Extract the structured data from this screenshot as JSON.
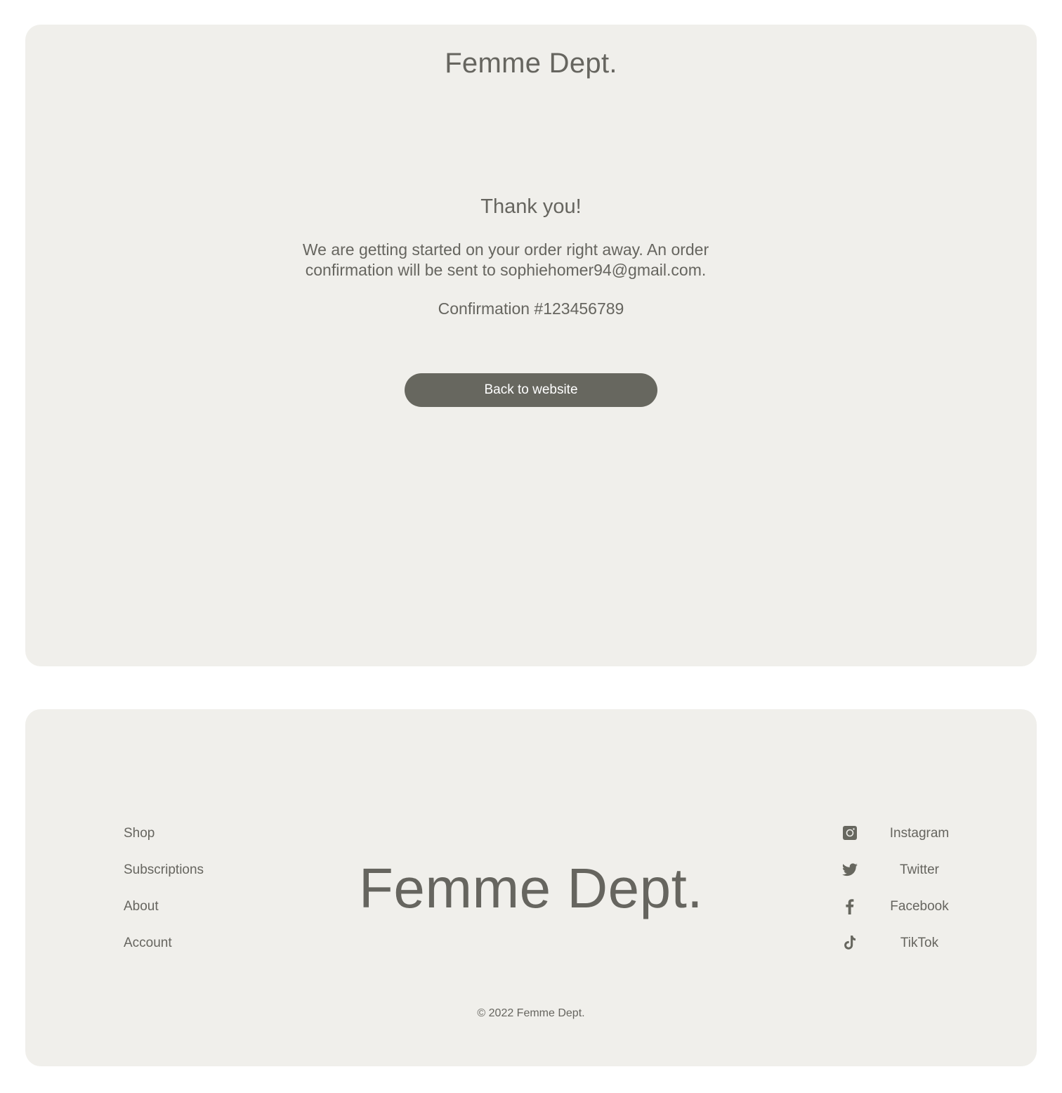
{
  "header": {
    "brand": "Femme Dept."
  },
  "confirmation": {
    "title": "Thank you!",
    "message": "We are getting started on your order right away. An order confirmation will be sent to sophiehomer94@gmail.com.",
    "number_text": "Confirmation #123456789",
    "back_button_label": "Back to website"
  },
  "footer": {
    "nav": [
      {
        "label": "Shop"
      },
      {
        "label": "Subscriptions"
      },
      {
        "label": "About"
      },
      {
        "label": "Account"
      }
    ],
    "brand": "Femme Dept.",
    "social": [
      {
        "label": "Instagram",
        "icon": "instagram-icon"
      },
      {
        "label": "Twitter",
        "icon": "twitter-icon"
      },
      {
        "label": "Facebook",
        "icon": "facebook-icon"
      },
      {
        "label": "TikTok",
        "icon": "tiktok-icon"
      }
    ],
    "copyright": "© 2022 Femme Dept."
  },
  "colors": {
    "panel_background": "#f0efeb",
    "text": "#66655f",
    "button_background": "#67675f",
    "button_text": "#ffffff"
  }
}
